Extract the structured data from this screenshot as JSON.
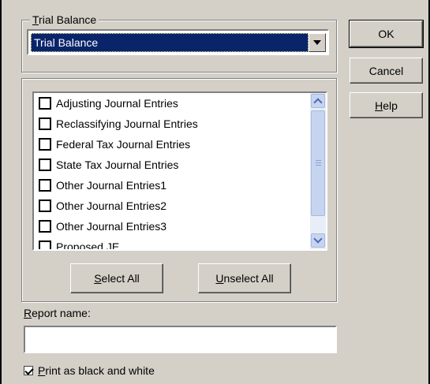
{
  "dialog": {
    "group_label_accel": "T",
    "group_label_rest": "rial Balance",
    "combo_value": "Trial Balance"
  },
  "buttons": {
    "ok": "OK",
    "cancel": "Cancel",
    "help_accel": "H",
    "help_rest": "elp",
    "select_all_accel": "S",
    "select_all_rest": "elect All",
    "unselect_all_accel": "U",
    "unselect_all_rest": "nselect All"
  },
  "journal_list": {
    "items": [
      {
        "label": "Adjusting Journal Entries",
        "checked": false
      },
      {
        "label": "Reclassifying Journal Entries",
        "checked": false
      },
      {
        "label": "Federal Tax Journal Entries",
        "checked": false
      },
      {
        "label": "State Tax Journal Entries",
        "checked": false
      },
      {
        "label": "Other Journal Entries1",
        "checked": false
      },
      {
        "label": "Other Journal Entries2",
        "checked": false
      },
      {
        "label": "Other Journal Entries3",
        "checked": false
      },
      {
        "label": "Proposed JE",
        "checked": false
      }
    ]
  },
  "report_name": {
    "label_accel": "R",
    "label_rest": "eport name:",
    "value": ""
  },
  "print_bw": {
    "checked": true,
    "label_accel": "P",
    "label_rest": "rint as black and white"
  },
  "icons": {
    "combo_dropdown": "chevron-down-icon",
    "scroll_up": "chevron-up-icon",
    "scroll_down": "chevron-down-icon"
  }
}
